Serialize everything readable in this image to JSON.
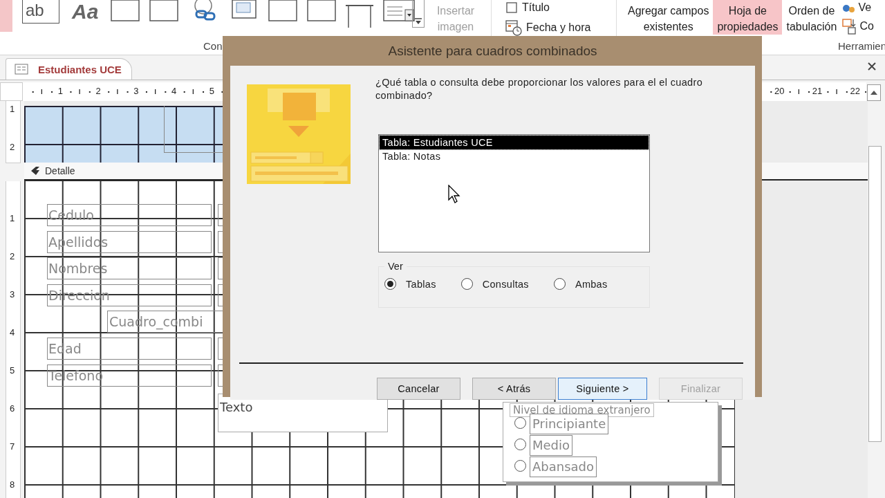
{
  "ribbon": {
    "gallery": [
      {
        "kind": "highlight"
      },
      {
        "kind": "textbox",
        "label": "ab"
      },
      {
        "kind": "label",
        "label": "Aa"
      },
      {
        "kind": "button"
      },
      {
        "kind": "tab"
      },
      {
        "kind": "hyperlink"
      },
      {
        "kind": "browser"
      },
      {
        "kind": "frame"
      },
      {
        "kind": "page"
      },
      {
        "kind": "pagebreak"
      },
      {
        "kind": "list"
      }
    ],
    "insert_image": {
      "lines": [
        "Insertar",
        "imagen"
      ],
      "disabled": true
    },
    "header_footer": [
      {
        "kind": "title",
        "label": "Título"
      },
      {
        "kind": "datetime",
        "label": "Fecha y hora"
      }
    ],
    "tools": [
      {
        "lines": [
          "Agregar campos",
          "existentes"
        ],
        "selected": false
      },
      {
        "lines": [
          "Hoja de",
          "propiedades"
        ],
        "selected": true
      },
      {
        "lines": [
          "Orden de",
          "tabulación"
        ],
        "selected": false
      }
    ],
    "extra": [
      {
        "kind": "view",
        "label": "Ve"
      },
      {
        "kind": "convert",
        "label": "Co"
      }
    ],
    "group_labels": [
      "Con",
      "Herramien"
    ]
  },
  "document_tab": {
    "label": "Estudiantes UCE",
    "selected": true
  },
  "rulers": {
    "top_start": [
      "1",
      "2",
      "3",
      "4",
      "5"
    ],
    "top_end": [
      "20",
      "21",
      "22"
    ],
    "header": [
      "1",
      "2"
    ],
    "detail": [
      "1",
      "2",
      "3",
      "4",
      "5",
      "6",
      "7",
      "8"
    ]
  },
  "form": {
    "detail_section": "Detalle",
    "rows": [
      {
        "kind": "field",
        "label": "Cedulo"
      },
      {
        "kind": "field",
        "label": "Apellidos"
      },
      {
        "kind": "field",
        "label": "Nombres"
      },
      {
        "kind": "field",
        "label": "Direccion"
      },
      {
        "kind": "combo",
        "label": "Cuadro_combi"
      },
      {
        "kind": "field",
        "label": "Edad"
      },
      {
        "kind": "field",
        "label": "Telefono"
      }
    ],
    "text_box": "Texto",
    "option_group": {
      "label": "Nivel de idioma extranjero",
      "options": [
        {
          "label": "Principiante",
          "selected": false
        },
        {
          "label": "Medio",
          "selected": false
        },
        {
          "label": "Abansado",
          "selected": false
        }
      ]
    }
  },
  "dialog": {
    "title": "Asistente para cuadros combinados",
    "prompt": "¿Qué tabla o consulta debe proporcionar los valores para el el cuadro combinado?",
    "list": [
      {
        "label": "Tabla: Estudiantes UCE",
        "selected": true
      },
      {
        "label": "Tabla: Notas",
        "selected": false
      }
    ],
    "view": {
      "label": "Ver",
      "options": [
        {
          "label": "Tablas",
          "selected": true
        },
        {
          "label": "Consultas",
          "selected": false
        },
        {
          "label": "Ambas",
          "selected": false
        }
      ]
    },
    "buttons": [
      {
        "label": "Cancelar",
        "default": false,
        "disabled": false
      },
      {
        "label": "< Atrás",
        "default": false,
        "disabled": false
      },
      {
        "label": "Siguiente >",
        "default": true,
        "disabled": false
      },
      {
        "label": "Finalizar",
        "default": false,
        "disabled": true
      }
    ]
  }
}
